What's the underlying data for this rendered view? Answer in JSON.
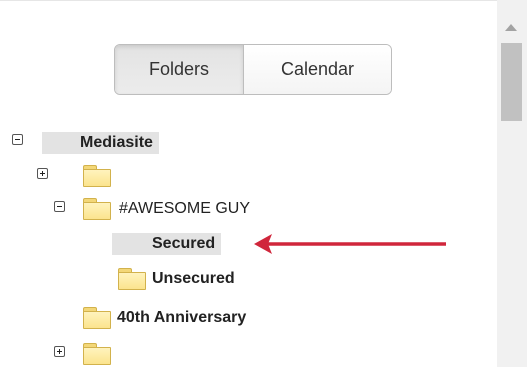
{
  "view_toggle": {
    "folders_label": "Folders",
    "calendar_label": "Calendar",
    "selected": "Folders"
  },
  "tree": {
    "root": {
      "label": "Mediasite",
      "expanded": true
    },
    "items": [
      {
        "label": "",
        "redacted": true,
        "expanded": false
      },
      {
        "label": "#AWESOME GUY",
        "expanded": true,
        "children": [
          {
            "label": "Secured",
            "selected": true
          },
          {
            "label": "Unsecured"
          }
        ]
      },
      {
        "label": "40th Anniversary"
      },
      {
        "label": "",
        "redacted": true,
        "expanded": false
      }
    ]
  },
  "colors": {
    "annotation_arrow": "#d0263b",
    "folder_fill": "#fbe48d",
    "selected_bg": "#e3e3e3"
  }
}
